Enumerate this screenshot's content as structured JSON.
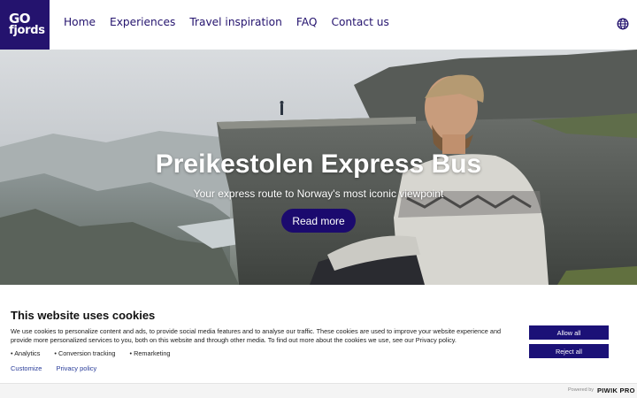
{
  "brand": {
    "logo_line1": "GO",
    "logo_line2": "fjords",
    "color": "#24136e"
  },
  "nav": {
    "items": [
      {
        "label": "Home"
      },
      {
        "label": "Experiences"
      },
      {
        "label": "Travel inspiration"
      },
      {
        "label": "FAQ"
      },
      {
        "label": "Contact us"
      }
    ],
    "language_icon": "globe-icon"
  },
  "hero": {
    "title": "Preikestolen Express Bus",
    "subtitle": "Your express route to Norway's most iconic viewpoint",
    "button_label": "Read more"
  },
  "cookie_banner": {
    "title": "This website uses cookies",
    "description": "We use cookies to personalize content and ads, to provide social media features and to analyse our traffic. These cookies are used to improve your website experience and provide more personalized services to you, both on this website and through other media. To find out more about the cookies we use, see our Privacy policy.",
    "options": [
      "Analytics",
      "Conversion tracking",
      "Remarketing"
    ],
    "customize_label": "Customize",
    "privacy_label": "Privacy policy",
    "allow_label": "Allow all",
    "reject_label": "Reject all"
  },
  "footer": {
    "powered_by": "Powered by",
    "vendor": "PIWIK PRO"
  }
}
